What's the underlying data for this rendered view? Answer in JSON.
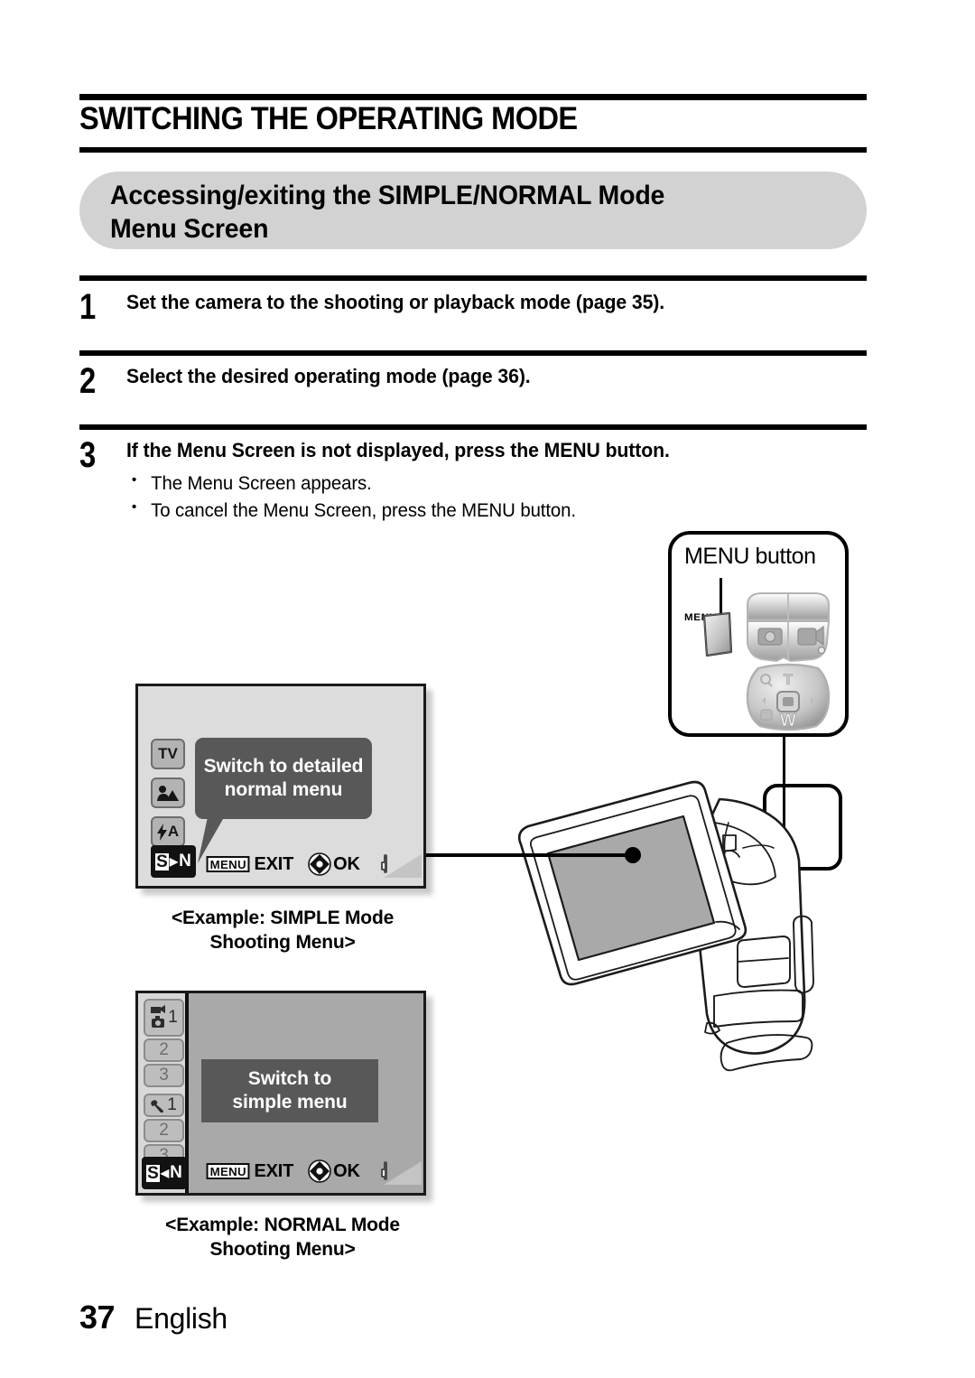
{
  "header": {
    "chapter_title": "SWITCHING THE OPERATING MODE",
    "section_title": "Accessing/exiting the SIMPLE/NORMAL Mode\nMenu Screen"
  },
  "steps": [
    {
      "number": "1",
      "text": "Set the camera to the shooting or playback mode (page 35)."
    },
    {
      "number": "2",
      "text": "Select the desired operating mode (page 36)."
    },
    {
      "number": "3",
      "text": "If the Menu Screen is not displayed, press the MENU button.",
      "bullets": [
        "The Menu Screen appears.",
        "To cancel the Menu Screen, press the MENU button."
      ]
    }
  ],
  "menu_callout": {
    "title": "MENU button",
    "button_label": "MENU",
    "photo_label": "PHOTO",
    "movie_label": "MOVIE",
    "zoom_tele": "T",
    "zoom_wide": "W"
  },
  "lcd_simple": {
    "caption": "<Example: SIMPLE Mode\nShooting Menu>",
    "message": "Switch to detailed\nnormal menu",
    "icons": [
      {
        "name": "tv-icon",
        "label": "TV"
      },
      {
        "name": "scene-icon",
        "label": ""
      },
      {
        "name": "flash-auto-icon",
        "label": "A"
      }
    ],
    "mode_chip": {
      "s": "S",
      "arrow": "▶",
      "n": "N"
    },
    "bottom_bar": {
      "menu_badge": "MENU",
      "exit_label": "EXIT",
      "ok_label": "OK"
    }
  },
  "lcd_normal": {
    "caption": "<Example: NORMAL Mode\nShooting Menu>",
    "message": "Switch to\nsimple menu",
    "tabs": [
      {
        "name": "shooting-tab-1",
        "num": "1",
        "icon": "camera-icon"
      },
      {
        "name": "shooting-tab-2",
        "num": "2",
        "icon": ""
      },
      {
        "name": "shooting-tab-3",
        "num": "3",
        "icon": ""
      },
      {
        "name": "setup-tab-1",
        "num": "1",
        "icon": "wrench-icon"
      },
      {
        "name": "setup-tab-2",
        "num": "2",
        "icon": ""
      },
      {
        "name": "setup-tab-3",
        "num": "3",
        "icon": ""
      }
    ],
    "mode_chip": {
      "s": "S",
      "arrow": "◀",
      "n": "N"
    },
    "bottom_bar": {
      "menu_badge": "MENU",
      "exit_label": "EXIT",
      "ok_label": "OK"
    }
  },
  "footer": {
    "page_number": "37",
    "language": "English"
  },
  "colors": {
    "banner_grey": "#d2d2d2",
    "lcd_simple_bg": "#dcdcdc",
    "lcd_normal_bg": "#a9a9a9",
    "message_box": "#585858",
    "ink": "#000000"
  }
}
